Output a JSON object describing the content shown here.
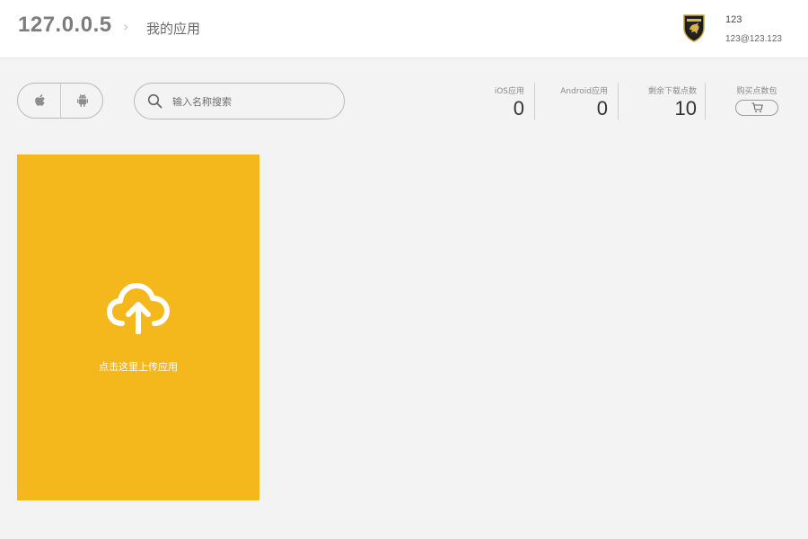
{
  "header": {
    "site_title": "127.0.0.5",
    "breadcrumb_separator": "›",
    "page_title": "我的应用",
    "user": {
      "name": "123",
      "email": "123@123.123",
      "avatar_icon": "lamborghini-bull-shield-icon"
    }
  },
  "toolbar": {
    "platforms": [
      {
        "name": "iOS",
        "icon": "apple-icon"
      },
      {
        "name": "Android",
        "icon": "android-icon"
      }
    ],
    "search": {
      "placeholder": "输入名称搜索",
      "value": "",
      "icon": "search-icon"
    }
  },
  "stats": {
    "ios": {
      "label": "iOS应用",
      "value": "0"
    },
    "android": {
      "label": "Android应用",
      "value": "0"
    },
    "downloads_left": {
      "label": "剩余下载点数",
      "value": "10"
    },
    "buy": {
      "label": "购买点数包",
      "icon": "cart-icon"
    }
  },
  "upload_card": {
    "label": "点击这里上传应用",
    "icon": "cloud-upload-icon"
  },
  "colors": {
    "page_background": "#f3f3f3",
    "header_background": "#ffffff",
    "upload_card": "#f5b81c",
    "accent_text": "#ffffff"
  }
}
